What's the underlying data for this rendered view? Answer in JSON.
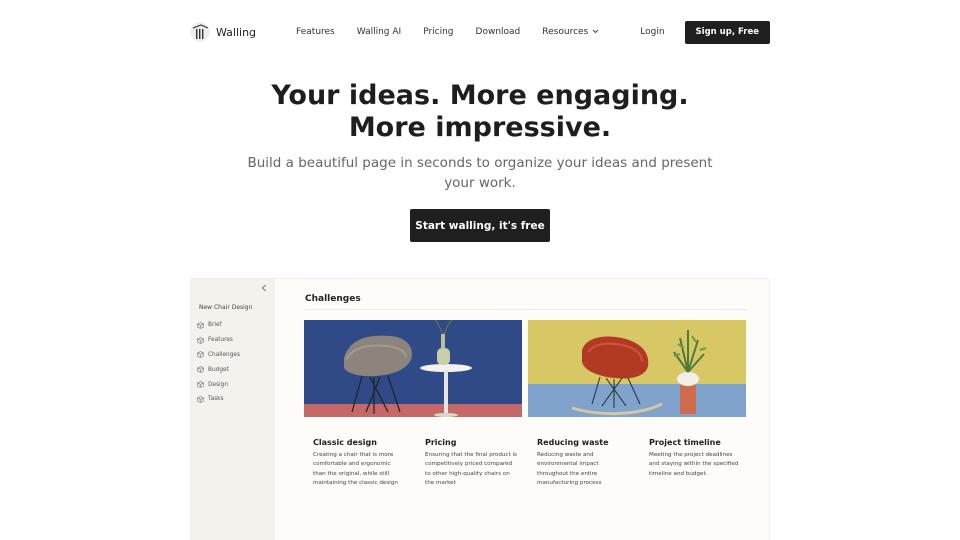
{
  "brand": {
    "name": "Walling",
    "logo_icon": "walling-logo-icon"
  },
  "nav": {
    "links": [
      "Features",
      "Walling AI",
      "Pricing",
      "Download",
      "Resources"
    ],
    "login": "Login",
    "signup": "Sign up, Free"
  },
  "hero": {
    "title_line1": "Your ideas. More engaging.",
    "title_line2": "More impressive.",
    "subtitle": "Build a beautiful page in seconds to organize your ideas and present your work.",
    "cta": "Start walling, it's free"
  },
  "app": {
    "collapse_icon": "chevron-left-icon",
    "sidebar": {
      "title": "New Chair Design",
      "items": [
        "Brief",
        "Features",
        "Challenges",
        "Budget",
        "Design",
        "Tasks"
      ],
      "item_icon": "cube-icon"
    },
    "section_title": "Challenges",
    "images": [
      {
        "name": "gray-chair-image",
        "colors": {
          "background": "#2f4a86",
          "floor": "#c56868"
        }
      },
      {
        "name": "red-rocking-chair-image",
        "colors": {
          "background": "#d8c865",
          "floor": "#7fa3cc"
        }
      }
    ],
    "cards": [
      {
        "title": "Classic design",
        "body": "Creating a chair that is more comfortable and ergonomic than the original, while still maintaining the classic design"
      },
      {
        "title": "Pricing",
        "body": "Ensuring that the final product is competitively priced compared to other high-quality chairs on the market"
      },
      {
        "title": "Reducing waste",
        "body": "Reducing waste and environmental impact throughout the entire manufacturing process"
      },
      {
        "title": "Project timeline",
        "body": "Meeting the project deadlines and staying within the specified timeline and budget."
      }
    ]
  },
  "colors": {
    "primary_button": "#1f1f1f",
    "sidebar_bg": "#f4f2ec"
  }
}
